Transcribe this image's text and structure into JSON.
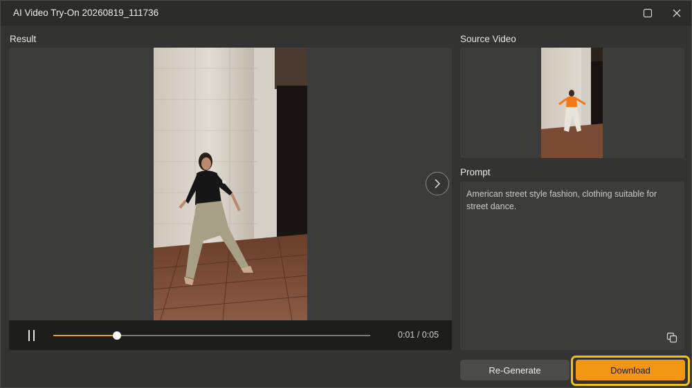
{
  "window": {
    "title": "AI Video Try-On 20260819_111736",
    "controls": [
      "maximize-icon",
      "close-icon"
    ]
  },
  "result": {
    "label": "Result",
    "player": {
      "state": "playing",
      "pause_icon": "pause-icon",
      "next_icon": "chevron-right-icon",
      "time_display": "0:01 / 0:05",
      "progress_fraction": 0.2
    }
  },
  "source": {
    "label": "Source Video"
  },
  "prompt": {
    "label": "Prompt",
    "text": "American street style fashion, clothing suitable for street dance.",
    "copy_icon": "copy-icon"
  },
  "actions": {
    "regenerate_label": "Re-Generate",
    "download_label": "Download"
  },
  "colors": {
    "accent": "#f29614",
    "highlight_ring": "#f2c20f",
    "background": "#333331",
    "panel": "#3c3c3a"
  }
}
